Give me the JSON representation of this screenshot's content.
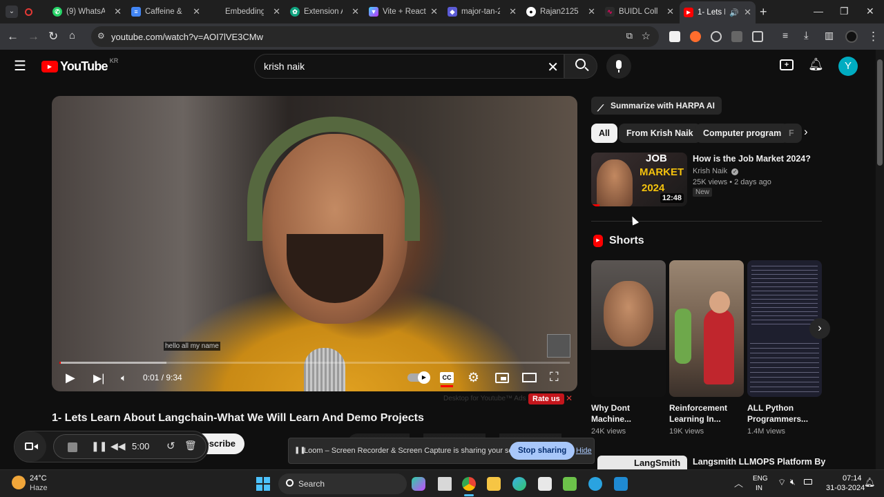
{
  "browser": {
    "tabs": [
      {
        "title": "",
        "color": "#e53935"
      },
      {
        "title": "(9) WhatsAp",
        "color": "#25d366",
        "icon": "whatsapp-icon"
      },
      {
        "title": "Caffeine & C",
        "color": "#4285f4",
        "icon": "docs-icon"
      },
      {
        "title": "Embeddings",
        "color": "#1f1f1f",
        "icon": "blank-icon"
      },
      {
        "title": "Extension A",
        "color": "#10a37f",
        "icon": "openai-icon"
      },
      {
        "title": "Vite + React",
        "color": "#a259ff",
        "icon": "vite-icon"
      },
      {
        "title": "major-tan-2",
        "color": "#5b5bd6",
        "icon": "shield-icon"
      },
      {
        "title": "Rajan21252",
        "color": "#ffffff",
        "icon": "github-icon"
      },
      {
        "title": "BUIDL Colle",
        "color": "#cc3366",
        "icon": "buidl-icon"
      },
      {
        "title": "1- Lets L",
        "color": "#ff0000",
        "icon": "youtube-icon"
      }
    ],
    "url": "youtube.com/watch?v=AOI7lVE3CMw"
  },
  "youtube": {
    "logo_text": "YouTube",
    "region": "KR",
    "search_query": "krish naik",
    "avatar_letter": "Y"
  },
  "player": {
    "caption": "hello all my name",
    "time": "0:01 / 9:34",
    "progress_fraction": 0.002,
    "buffer_fraction": 0.21
  },
  "video": {
    "title": "1- Lets Learn About Langchain-What We Will Learn And Demo Projects",
    "subscribe_label": "bscribe",
    "rate_hint": "Desktop for Youtube™ Ads",
    "rate_label": "Rate us"
  },
  "sidebar": {
    "harpa_label": "Summarize with HARPA AI",
    "chips": [
      "All",
      "From Krish Naik",
      "Computer program",
      "F"
    ],
    "featured": {
      "title": "How is the Job Market 2024?",
      "channel": "Krish Naik",
      "meta": "25K views • 2 days ago",
      "badge": "New",
      "duration": "12:48",
      "thumb_line1": "JOB",
      "thumb_line2": "MARKET",
      "thumb_line3": "2024"
    },
    "shorts_heading": "Shorts",
    "shorts": [
      {
        "title": "Why Dont Machine...",
        "views": "24K views"
      },
      {
        "title": "Reinforcement Learning In...",
        "views": "19K views"
      },
      {
        "title": "ALL Python Programmers...",
        "views": "1.4M views"
      }
    ],
    "next_item": {
      "thumb_text": "LangSmith",
      "title": "Langsmith LLMOPS Platform By"
    }
  },
  "loom": {
    "timer": "5:00",
    "message": "Loom – Screen Recorder & Screen Capture is sharing your screen.",
    "stop_label": "Stop sharing",
    "hide_label": "Hide"
  },
  "taskbar": {
    "weather_temp": "24°C",
    "weather_desc": "Haze",
    "search_label": "Search",
    "lang_line1": "ENG",
    "lang_line2": "IN",
    "time": "07:14",
    "date": "31-03-2024"
  }
}
